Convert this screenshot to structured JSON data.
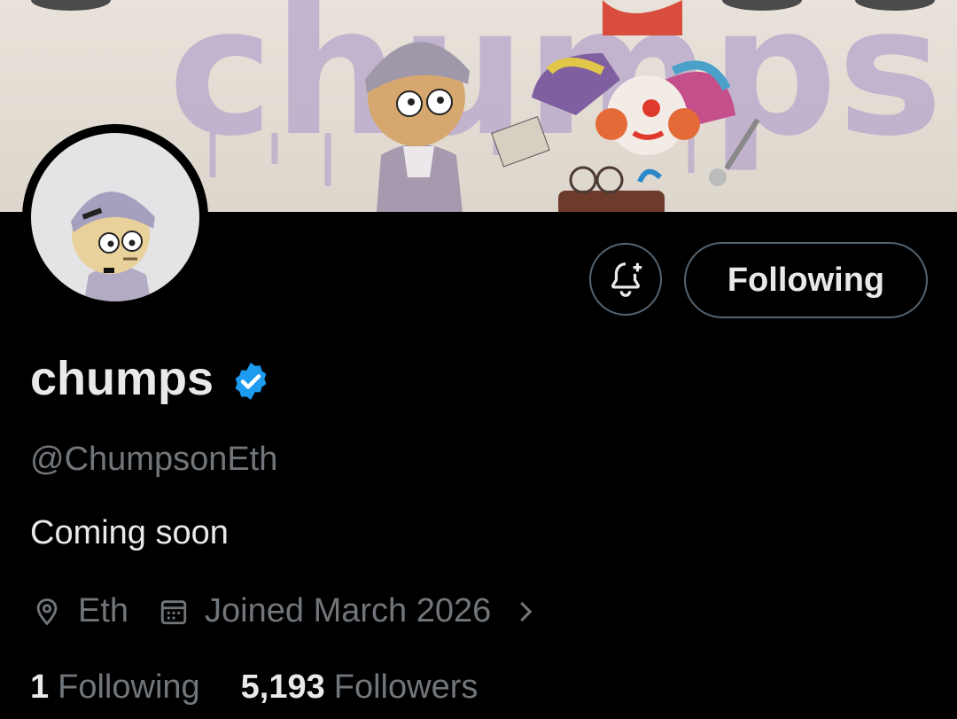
{
  "profile": {
    "display_name": "chumps",
    "handle": "@ChumpsonEth",
    "bio": "Coming soon",
    "location": "Eth",
    "joined": "Joined March 2026",
    "following_count": "1",
    "following_label": "Following",
    "followers_count": "5,193",
    "followers_label": "Followers",
    "verified": true
  },
  "actions": {
    "follow_label": "Following",
    "notify_icon": "bell-plus-icon"
  },
  "banner": {
    "graffiti_text": "chumps"
  },
  "colors": {
    "background": "#000000",
    "primary_text": "#e7e9ea",
    "secondary_text": "#71767b",
    "border": "#536471",
    "verified_blue": "#1d9bf0"
  }
}
